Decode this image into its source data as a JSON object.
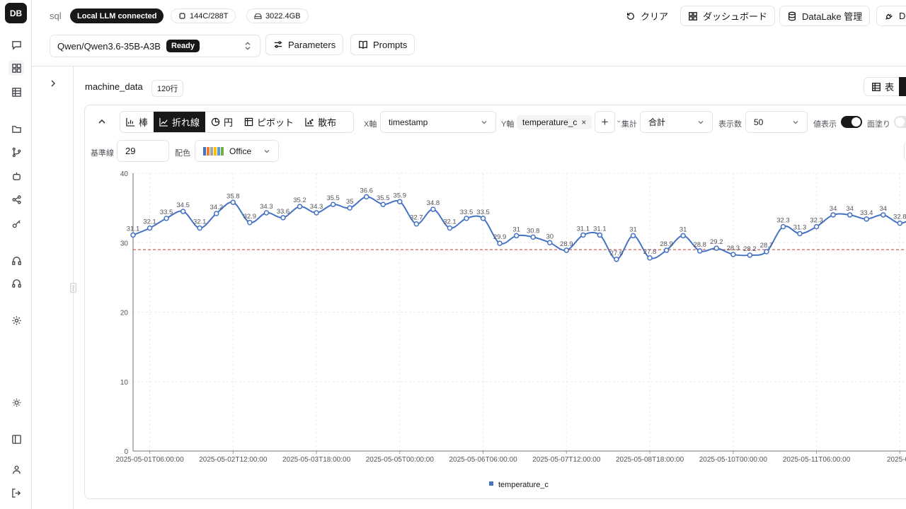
{
  "app": {
    "logo": "DB",
    "db_type": "sql",
    "llm_status": "Local LLM connected",
    "cpu": "144C/288T",
    "storage": "3022.4GB"
  },
  "header": {
    "clear_label": "クリア",
    "dashboard_label": "ダッシュボード",
    "datalake_label": "DataLake 管理",
    "extra_label": "D"
  },
  "model": {
    "name": "Qwen/Qwen3.6-35B-A3B",
    "status": "Ready",
    "parameters_label": "Parameters",
    "prompts_label": "Prompts"
  },
  "table": {
    "name": "machine_data",
    "row_count": "120行",
    "view_table_label": "表"
  },
  "chart_tabs": [
    "棒",
    "折れ線",
    "円",
    "ピボット",
    "散布"
  ],
  "controls": {
    "x_axis_label": "X軸",
    "x_axis_value": "timestamp",
    "y_axis_label": "Y軸",
    "y_axis_value": "temperature_c",
    "agg_label": "集計",
    "agg_value": "合計",
    "limit_label": "表示数",
    "limit_value": "50",
    "show_values_label": "値表示",
    "fill_label": "面塗り",
    "baseline_label": "基準線",
    "baseline_value": "29",
    "palette_label": "配色",
    "palette_value": "Office"
  },
  "colors": {
    "line": "#4472c4",
    "baseline": "#c0392b",
    "palette": [
      "#4472c4",
      "#ed7d31",
      "#a5a5a5",
      "#ffc000",
      "#5b9bd5",
      "#70ad47"
    ]
  },
  "chart_data": {
    "type": "line",
    "series": [
      {
        "name": "temperature_c",
        "values": [
          31.1,
          32.1,
          33.5,
          34.5,
          32.1,
          34.2,
          35.8,
          32.9,
          34.3,
          33.6,
          35.2,
          34.3,
          35.5,
          35,
          36.6,
          35.5,
          35.9,
          32.7,
          34.8,
          32.1,
          33.5,
          33.5,
          29.9,
          31,
          30.8,
          30,
          28.9,
          31.1,
          31.1,
          27.6,
          31,
          27.8,
          28.9,
          31,
          28.8,
          29.2,
          28.3,
          28.2,
          28.7,
          32.3,
          31.3,
          32.3,
          34,
          34,
          33.4,
          34,
          32.8,
          33.8
        ]
      }
    ],
    "x_tick_labels": [
      "2025-05-01T06:00:00",
      "2025-05-02T12:00:00",
      "2025-05-03T18:00:00",
      "2025-05-05T00:00:00",
      "2025-05-06T06:00:00",
      "2025-05-07T12:00:00",
      "2025-05-08T18:00:00",
      "2025-05-10T00:00:00",
      "2025-05-11T06:00:00",
      "2025-05"
    ],
    "y_ticks": [
      0,
      10,
      20,
      30,
      40
    ],
    "ylim": [
      0,
      40
    ],
    "baseline": 29,
    "show_values": true,
    "grid": true,
    "legend": "bottom"
  }
}
